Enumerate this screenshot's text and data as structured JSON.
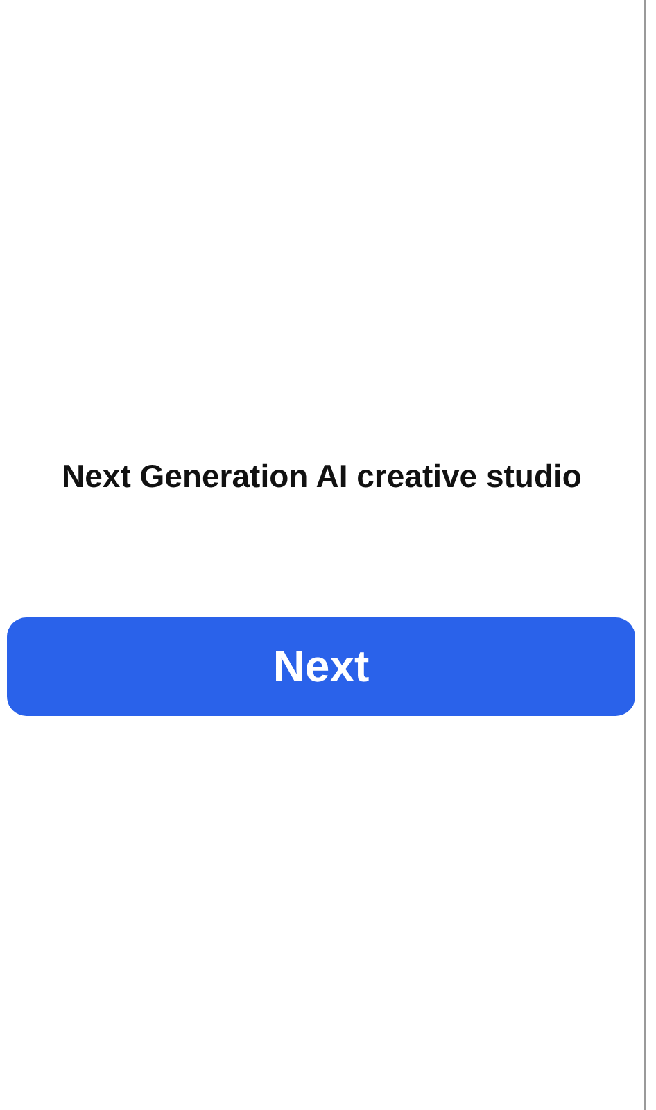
{
  "headline": "Next Generation AI creative studio",
  "button": {
    "label": "Next"
  }
}
